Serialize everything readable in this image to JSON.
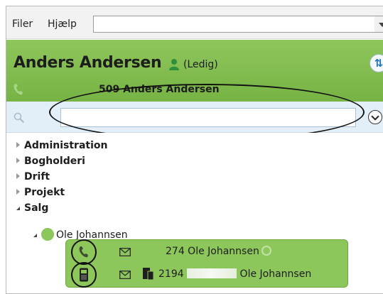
{
  "menu": {
    "file": "Filer",
    "help": "Hjælp"
  },
  "header": {
    "name": "Anders Andersen",
    "status": "(Ledig)",
    "extension": "509 Anders Andersen",
    "accent": "#7fbf4d"
  },
  "tree": {
    "groups": [
      "Administration",
      "Bogholderi",
      "Drift",
      "Projekt",
      "Salg"
    ],
    "contact": "Ole Johannsen"
  },
  "card": {
    "line1": "274 Ole Johannsen",
    "line2_prefix": "2194",
    "line2_name": "Ole Johannsen"
  }
}
